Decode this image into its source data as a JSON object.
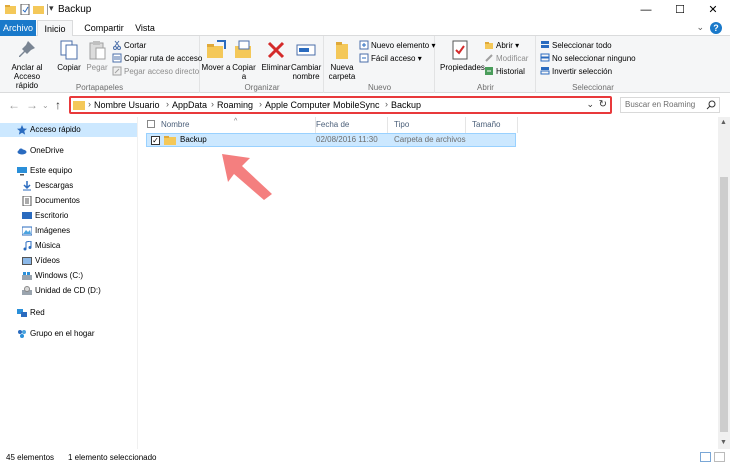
{
  "window": {
    "title": "Backup",
    "minimize": "—",
    "maximize": "☐",
    "close": "✕"
  },
  "tabs": {
    "file": "Archivo",
    "home": "Inicio",
    "share": "Compartir",
    "view": "Vista",
    "help": "?"
  },
  "ribbon": {
    "clipboard": {
      "label": "Portapapeles",
      "pin": "Anclar al Acceso rápido",
      "copy": "Copiar",
      "paste": "Pegar",
      "cut": "Cortar",
      "copy_path": "Copiar ruta de acceso",
      "paste_shortcut": "Pegar acceso directo"
    },
    "organize": {
      "label": "Organizar",
      "move": "Mover a",
      "copy_to": "Copiar a",
      "delete": "Eliminar",
      "rename": "Cambiar nombre"
    },
    "new": {
      "label": "Nuevo",
      "new_folder": "Nueva carpeta",
      "new_item": "Nuevo elemento",
      "easy_access": "Fácil acceso"
    },
    "open": {
      "label": "Abrir",
      "properties": "Propiedades",
      "open": "Abrir",
      "edit": "Modificar",
      "history": "Historial"
    },
    "select": {
      "label": "Seleccionar",
      "select_all": "Seleccionar todo",
      "select_none": "No seleccionar ninguno",
      "invert": "Invertir selección"
    }
  },
  "address": {
    "crumbs": [
      "Nombre Usuario",
      "AppData",
      "Roaming",
      "Apple Computer",
      "MobileSync",
      "Backup"
    ],
    "search_placeholder": "Buscar en Roaming"
  },
  "nav": {
    "quick_access": "Acceso rápido",
    "onedrive": "OneDrive",
    "this_pc": "Este equipo",
    "downloads": "Descargas",
    "documents": "Documentos",
    "desktop": "Escritorio",
    "pictures": "Imágenes",
    "music": "Música",
    "videos": "Vídeos",
    "windows_c": "Windows (C:)",
    "cd_d": "Unidad de CD (D:)",
    "network": "Red",
    "homegroup": "Grupo en el hogar"
  },
  "columns": {
    "name": "Nombre",
    "date": "Fecha de modifica...",
    "type": "Tipo",
    "size": "Tamaño"
  },
  "files": [
    {
      "name": "Backup",
      "date": "02/08/2016 11:30",
      "type": "Carpeta de archivos",
      "size": ""
    }
  ],
  "status": {
    "count": "45 elementos",
    "selected": "1 elemento seleccionado"
  },
  "colors": {
    "accent": "#1979ca",
    "highlight_border": "#e8393b",
    "selection": "#cce8ff",
    "arrow": "#f47f7f"
  }
}
